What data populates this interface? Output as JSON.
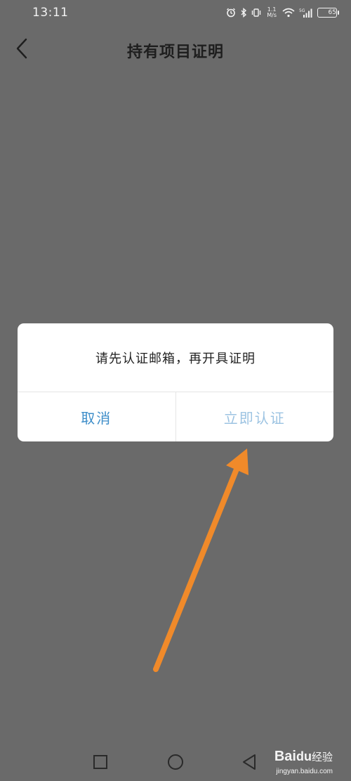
{
  "status_bar": {
    "time": "13:11",
    "net_speed_value": "1.1",
    "net_speed_unit": "M/s",
    "network": "5G",
    "battery": "65",
    "icons": [
      "alarm-icon",
      "bluetooth-icon",
      "vibrate-icon",
      "wifi-icon",
      "signal-icon",
      "battery-icon"
    ]
  },
  "header": {
    "title": "持有项目证明",
    "back_icon": "chevron-left-icon"
  },
  "dialog": {
    "message": "请先认证邮箱，再开具证明",
    "cancel_label": "取消",
    "confirm_label": "立即认证"
  },
  "annotation": {
    "color": "#f08a2a",
    "points_to": "confirm-button"
  },
  "nav_bar": {
    "icons": [
      "recent-apps-icon",
      "home-icon",
      "back-triangle-icon"
    ]
  },
  "watermark": {
    "brand": "Bai",
    "brand_tail": "经验",
    "url": "jingyan.baidu.com"
  },
  "colors": {
    "background": "#6a6a6a",
    "accent": "#3e8ec9",
    "accent_disabled": "#9cc3e2"
  }
}
